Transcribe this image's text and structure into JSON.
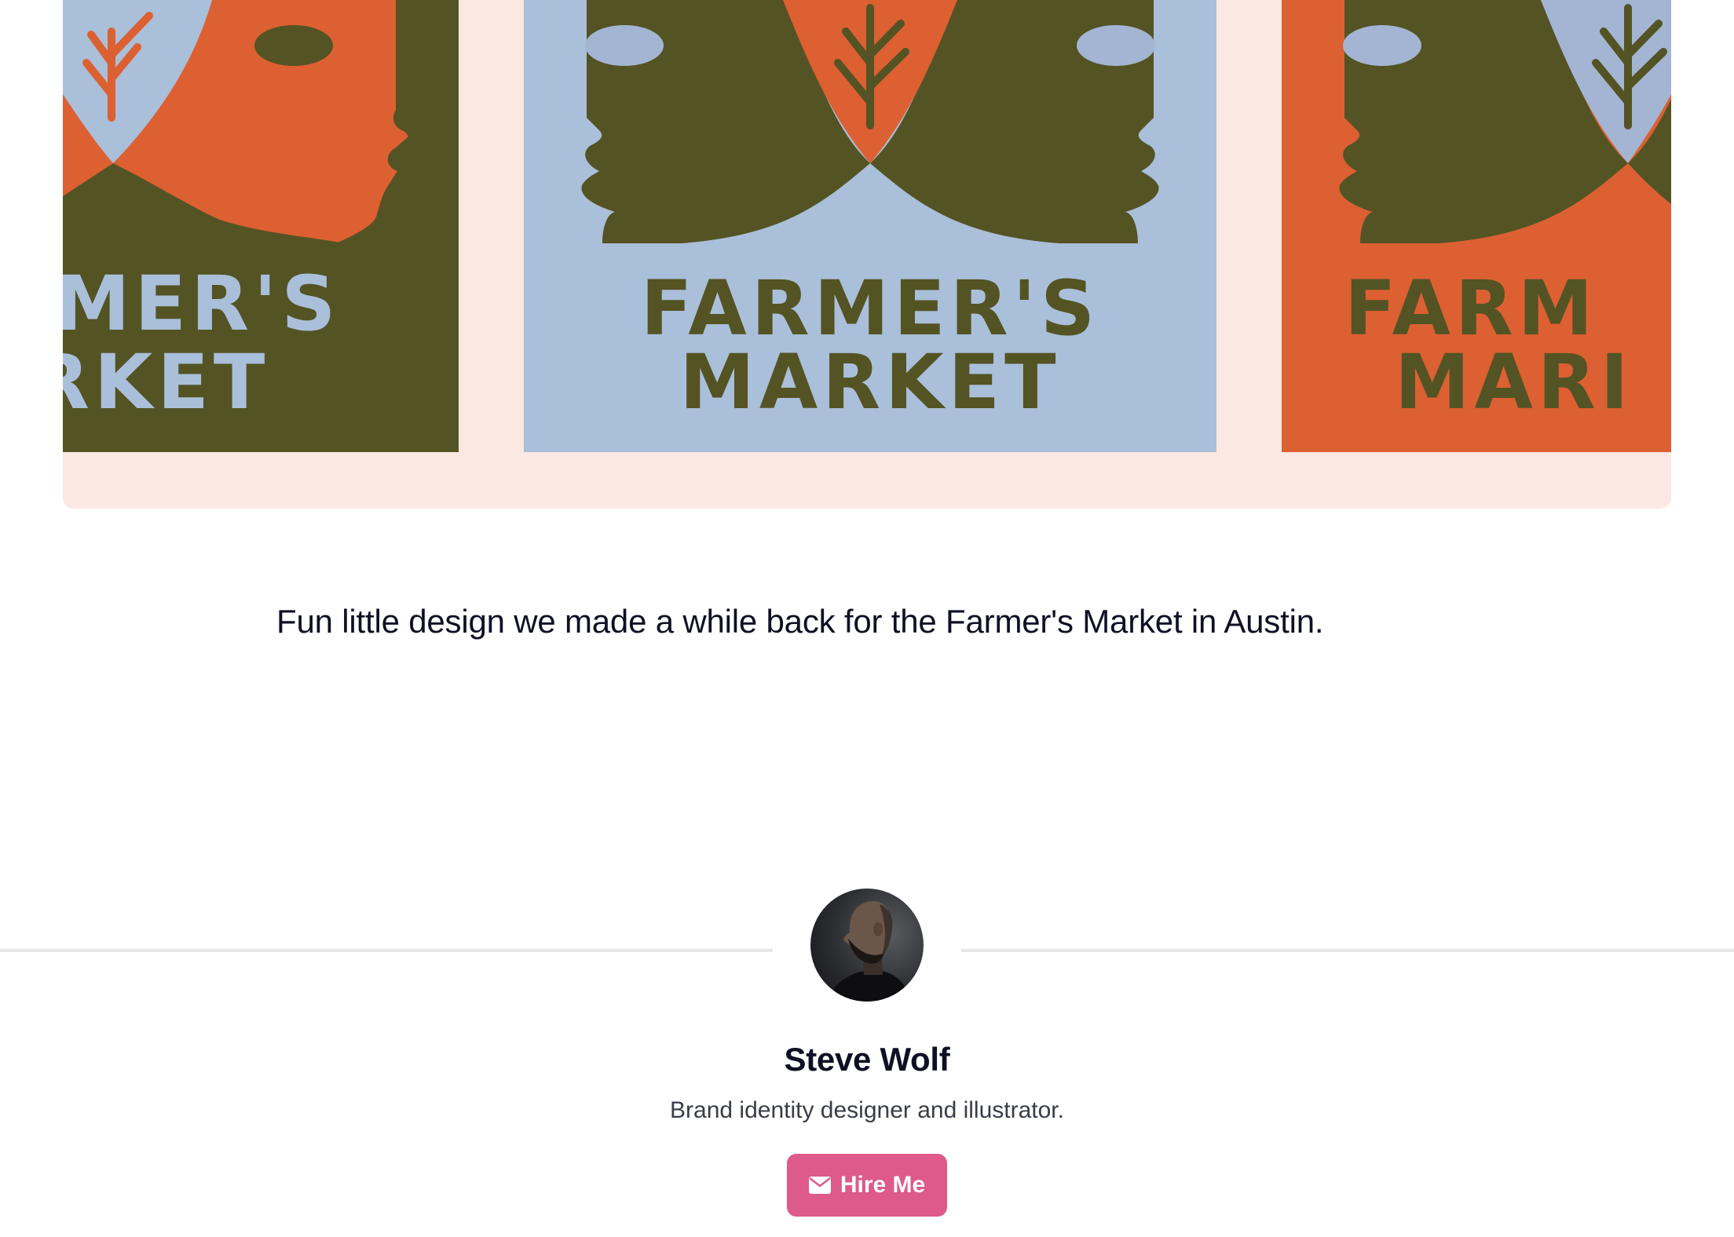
{
  "hero": {
    "artwork_line1": "FARMER'S",
    "artwork_line2": "MARKET",
    "colors": {
      "background": "#fbe8e2",
      "orange": "#dc6032",
      "olive": "#545324",
      "blue": "#aabfd9",
      "eye_blue": "#a3b5d3"
    }
  },
  "post": {
    "description": "Fun little design we made a while back for the Farmer's Market in Austin."
  },
  "author": {
    "name": "Steve Wolf",
    "bio": "Brand identity designer and illustrator.",
    "avatar_icon": "profile-photo"
  },
  "cta": {
    "hire_label": "Hire Me",
    "icon": "envelope-icon",
    "color": "#dd5a8a"
  }
}
